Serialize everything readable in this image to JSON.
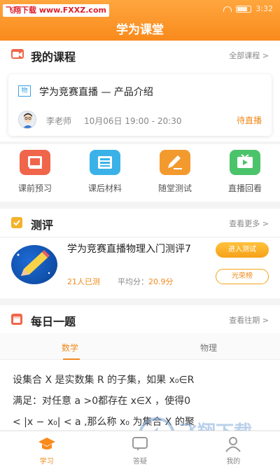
{
  "status_bar": {
    "time": "3:32"
  },
  "watermark": {
    "top_left": "飞翔下载 www.FXXZ.com",
    "bottom_right_title": "飞翔下载",
    "bottom_right_url": "www.FXXZ.com"
  },
  "header": {
    "title": "学为课堂"
  },
  "my_courses": {
    "title": "我的课程",
    "more": "全部课程 >",
    "card": {
      "badge": "物",
      "title": "学为竞赛直播 — 产品介绍",
      "teacher": "李老师",
      "time": "10月06日 19:00 - 20:30",
      "status": "待直播"
    }
  },
  "quick_actions": [
    {
      "label": "课前预习",
      "icon": "book-icon",
      "color": "#f0664a"
    },
    {
      "label": "课后材料",
      "icon": "tray-icon",
      "color": "#3ab2e8"
    },
    {
      "label": "随堂测试",
      "icon": "pencil-icon",
      "color": "#f29a2e"
    },
    {
      "label": "直播回看",
      "icon": "tv-icon",
      "color": "#4bc36b"
    }
  ],
  "evaluation": {
    "title": "测评",
    "more": "查看更多 >",
    "item": {
      "title": "学为竞赛直播物理入门测评7",
      "participants": "21人已测",
      "avg_label": "平均分：",
      "avg_value": "20.9分",
      "enter_button": "进入测试",
      "rank_button": "光荣榜"
    }
  },
  "daily": {
    "title": "每日一题",
    "more": "查看往期 >",
    "tabs": [
      "数学",
      "物理"
    ],
    "active_tab": 0,
    "question_lines": [
      "设集合 X 是实数集 R 的子集，如果 x₀∈R",
      "满足：对任意 a >0都存在 x∈X ，使得0",
      "< |x − x₀| < a ,那么称 x₀ 为集合 X 的聚"
    ]
  },
  "bottom_nav": [
    {
      "label": "学习",
      "icon": "graduation-cap-icon",
      "active": true
    },
    {
      "label": "答疑",
      "icon": "question-bubble-icon",
      "active": false
    },
    {
      "label": "我的",
      "icon": "user-icon",
      "active": false
    }
  ],
  "colors": {
    "accent": "#f98a1c",
    "accent_light": "#ffa63e"
  }
}
